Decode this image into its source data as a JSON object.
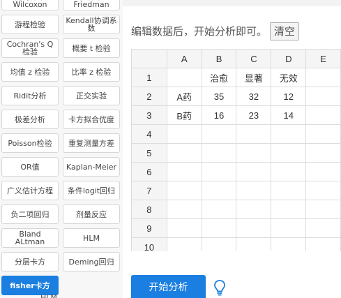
{
  "methods": [
    {
      "label": "配对样本 Wilcoxon"
    },
    {
      "label": "多样本 Friedman"
    },
    {
      "label": "游程检验"
    },
    {
      "label": "Kendall协调系数"
    },
    {
      "label": "Cochran's Q 检验"
    },
    {
      "label": "概要 t 检验"
    },
    {
      "label": "均值 z 检验"
    },
    {
      "label": "比率 z 检验"
    },
    {
      "label": "Ridit分析"
    },
    {
      "label": "正交实验"
    },
    {
      "label": "极差分析"
    },
    {
      "label": "卡方拟合优度"
    },
    {
      "label": "Poisson检验"
    },
    {
      "label": "重复测量方差"
    },
    {
      "label": "OR值"
    },
    {
      "label": "Kaplan-Meier"
    },
    {
      "label": "广义估计方程"
    },
    {
      "label": "条件logit回归"
    },
    {
      "label": "负二项回归"
    },
    {
      "label": "剂量反应"
    },
    {
      "label": "Bland ALtman"
    },
    {
      "label": "HLM"
    },
    {
      "label": "分层卡方"
    },
    {
      "label": "Deming回归"
    },
    {
      "label": "fisher卡方",
      "active": true
    }
  ],
  "cut_row_label": "HLM",
  "hint": {
    "text": "编辑数据后，开始分析即可。",
    "clear_label": "清空"
  },
  "sheet": {
    "columns": [
      "A",
      "B",
      "C",
      "D",
      "E"
    ],
    "rows": [
      {
        "num": "1",
        "cells": [
          "",
          "治愈",
          "显著",
          "无效",
          ""
        ]
      },
      {
        "num": "2",
        "cells": [
          "A药",
          "35",
          "32",
          "12",
          ""
        ]
      },
      {
        "num": "3",
        "cells": [
          "B药",
          "16",
          "23",
          "14",
          ""
        ]
      },
      {
        "num": "4",
        "cells": [
          "",
          "",
          "",
          "",
          ""
        ]
      },
      {
        "num": "5",
        "cells": [
          "",
          "",
          "",
          "",
          ""
        ]
      },
      {
        "num": "6",
        "cells": [
          "",
          "",
          "",
          "",
          ""
        ]
      },
      {
        "num": "7",
        "cells": [
          "",
          "",
          "",
          "",
          ""
        ]
      },
      {
        "num": "8",
        "cells": [
          "",
          "",
          "",
          "",
          ""
        ]
      },
      {
        "num": "9",
        "cells": [
          "",
          "",
          "",
          "",
          ""
        ]
      },
      {
        "num": "10",
        "cells": [
          "",
          "",
          "",
          "",
          ""
        ]
      }
    ]
  },
  "start_label": "开始分析",
  "icons": {
    "tip": "lightbulb-icon"
  },
  "colors": {
    "accent": "#1a7fe0",
    "grid": "#dcdcdc"
  }
}
